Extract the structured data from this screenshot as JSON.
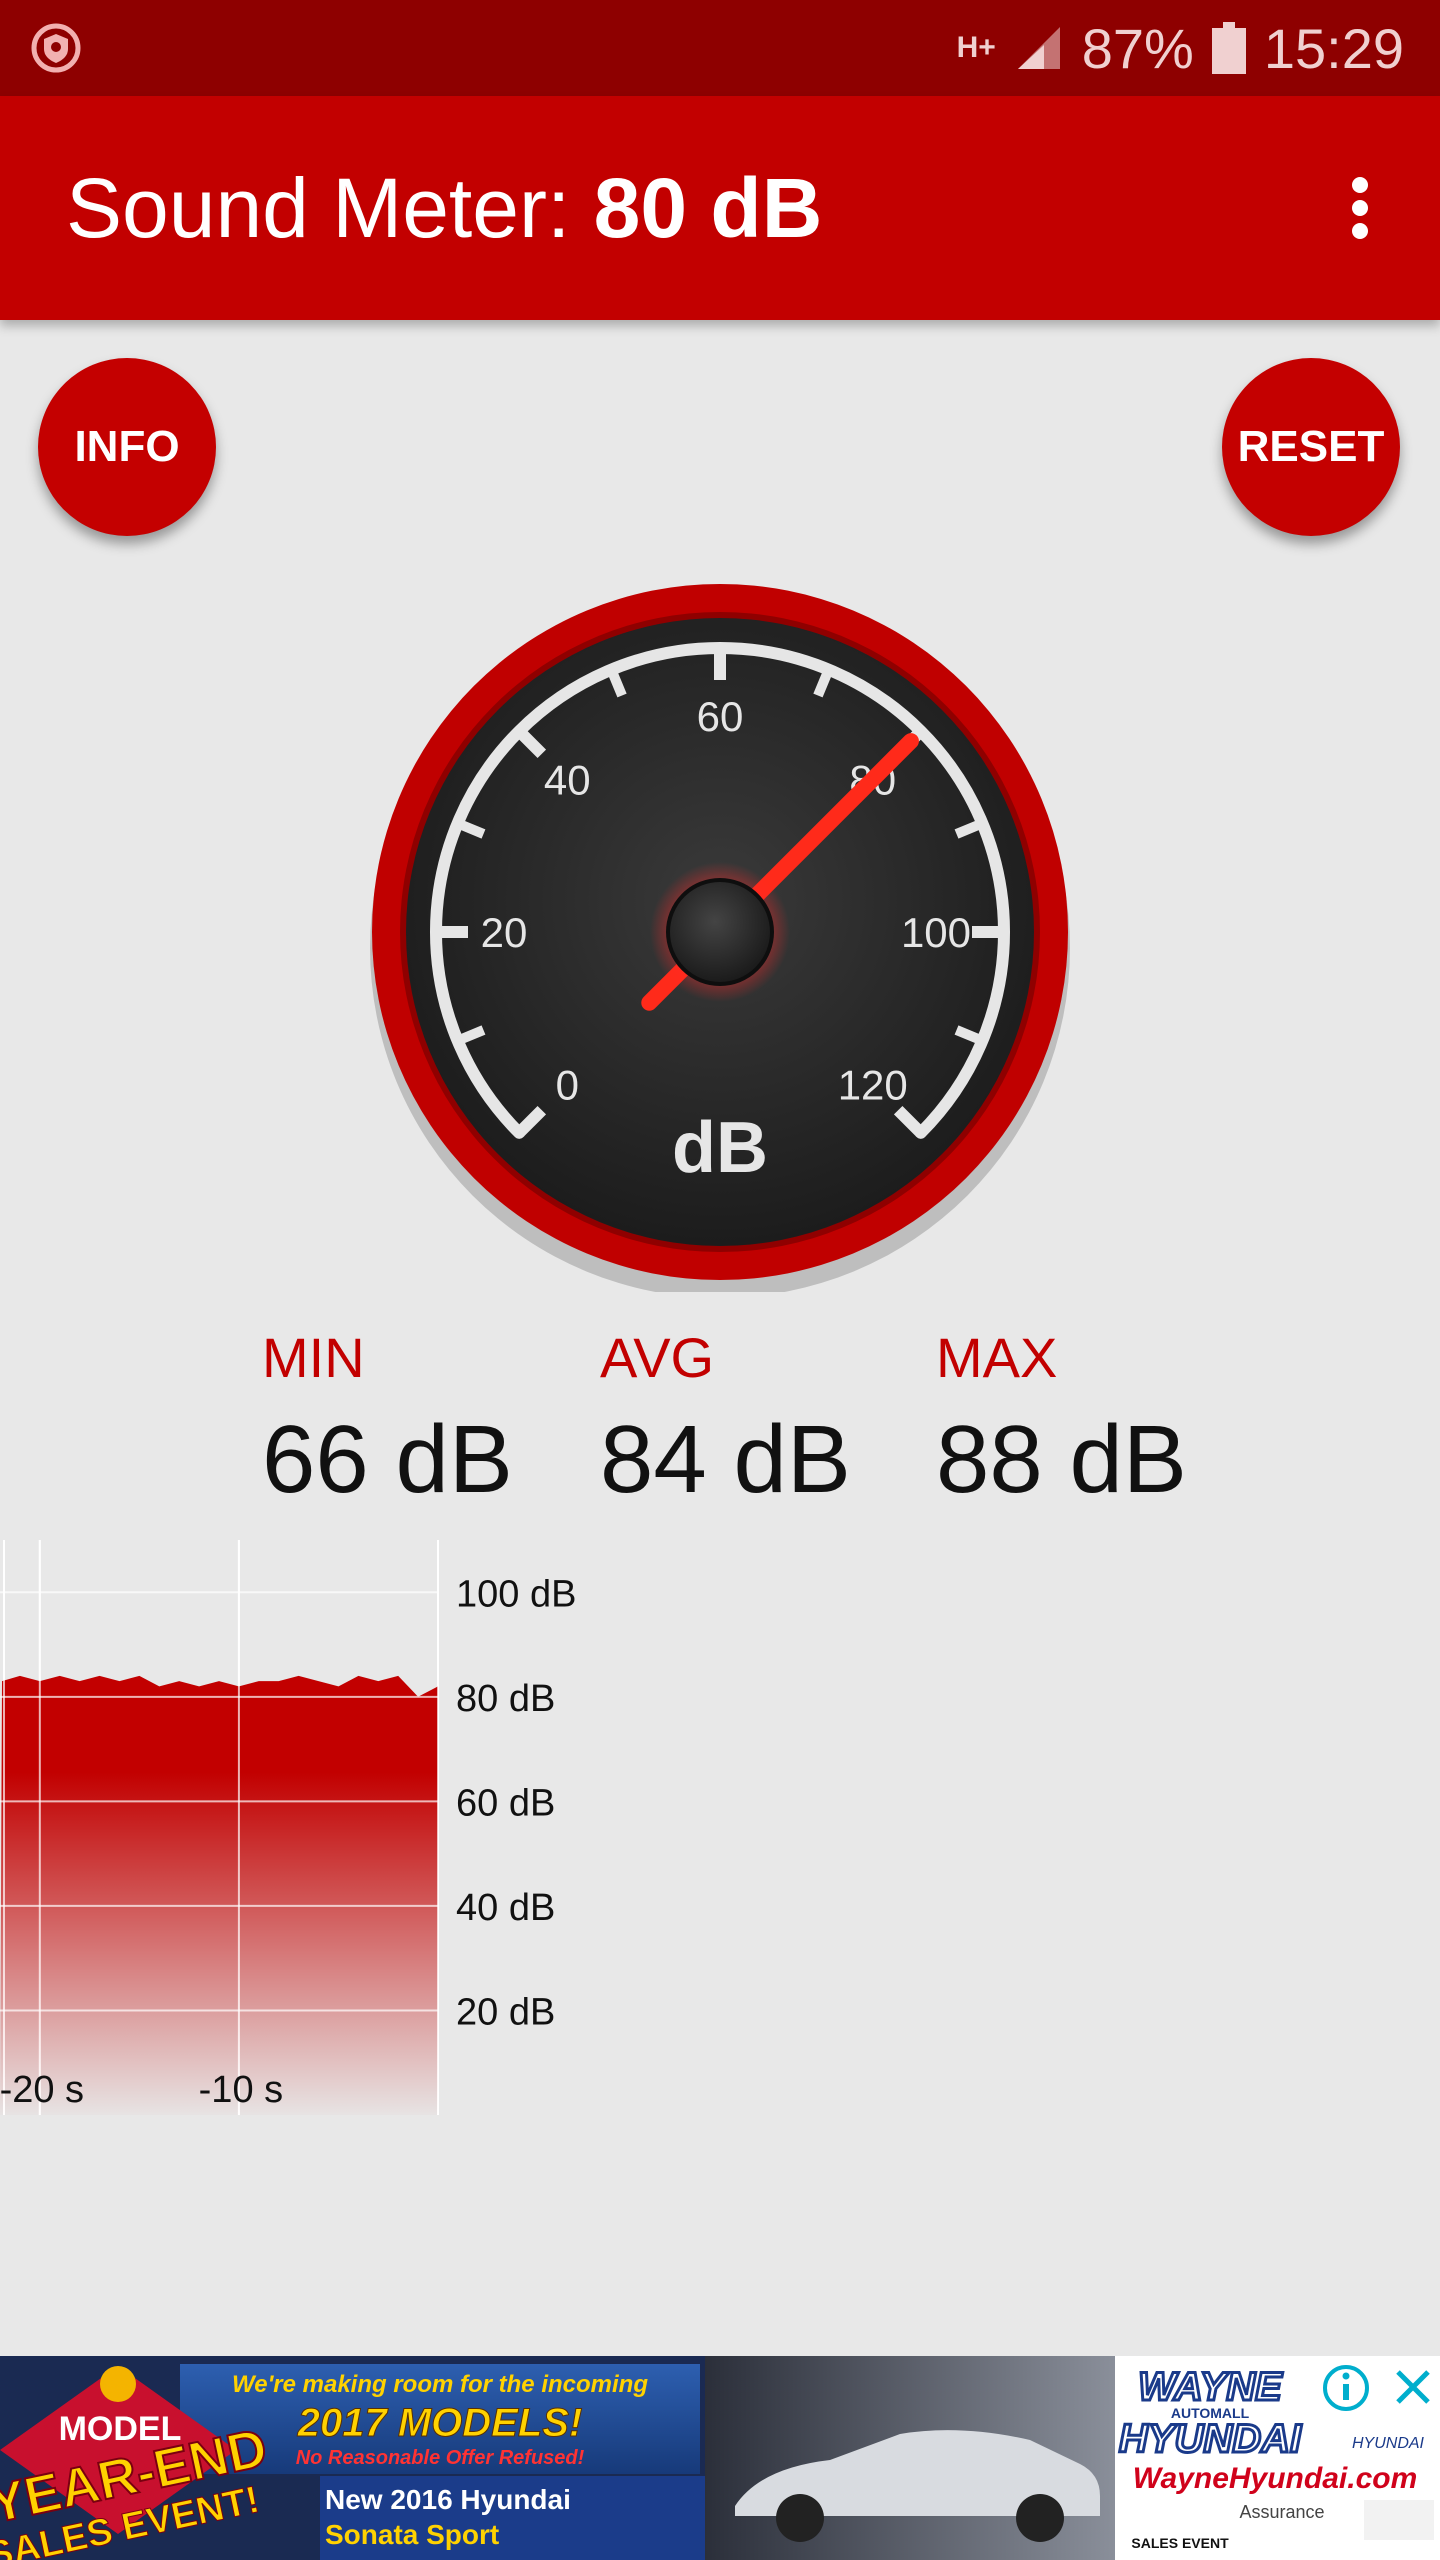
{
  "status_bar": {
    "network": "H+",
    "battery": "87%",
    "time": "15:29"
  },
  "app_bar": {
    "title_prefix": "Sound Meter: ",
    "title_value": "80 dB"
  },
  "buttons": {
    "info": "INFO",
    "reset": "RESET"
  },
  "gauge": {
    "unit": "dB",
    "reading": 80,
    "scale_min": 0,
    "scale_max": 120,
    "tick_labels": [
      "0",
      "20",
      "40",
      "60",
      "80",
      "100",
      "120"
    ]
  },
  "stats": {
    "min": {
      "label": "MIN",
      "value": "66 dB"
    },
    "avg": {
      "label": "AVG",
      "value": "84 dB"
    },
    "max": {
      "label": "MAX",
      "value": "88 dB"
    }
  },
  "chart_data": {
    "type": "area",
    "ylim": [
      0,
      110
    ],
    "y_ticks": [
      "100 dB",
      "80 dB",
      "60 dB",
      "40 dB",
      "20 dB"
    ],
    "x_ticks": [
      "-20 s",
      "-10 s"
    ],
    "x": [
      -21.9,
      -21,
      -20,
      -19,
      -18,
      -17,
      -16,
      -15,
      -14,
      -13,
      -12,
      -11,
      -10,
      -9,
      -8,
      -7,
      -6,
      -5,
      -4,
      -3,
      -2,
      -1,
      0
    ],
    "values": [
      83,
      84,
      83,
      84,
      83,
      84,
      83,
      84,
      82,
      83,
      82,
      83,
      82,
      83,
      83,
      84,
      83,
      82,
      84,
      83,
      84,
      80,
      82
    ],
    "color": "#c20000"
  },
  "ad": {
    "headline": "We're making room for the incoming",
    "models": "2017 MODELS!",
    "subline": "No Reasonable Offer Refused!",
    "badge_line1": "MODEL",
    "badge_line2": "YEAR-END",
    "badge_line3": "SALES EVENT!",
    "car_line1": "New 2016 Hyundai",
    "car_line2": "Sonata Sport",
    "dealer_line1": "WAYNE",
    "dealer_line2": "AUTOMALL",
    "dealer_line3": "HYUNDAI",
    "dealer_url": "WayneHyundai.com",
    "brand": "HYUNDAI",
    "footer1": "SALES EVENT",
    "footer2": "Assurance"
  },
  "colors": {
    "primary": "#c20000",
    "status": "#8e0000",
    "background": "#e8e8e8"
  }
}
